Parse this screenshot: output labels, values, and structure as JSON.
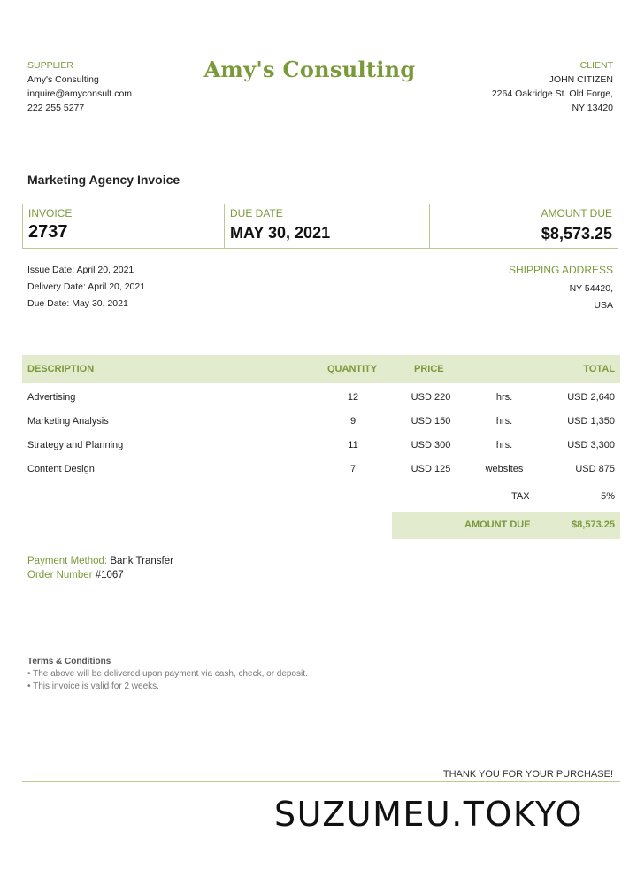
{
  "supplier": {
    "label": "SUPPLIER",
    "name": "Amy's Consulting",
    "email": "inquire@amyconsult.com",
    "phone": "222 255 5277"
  },
  "brand": "Amy's Consulting",
  "client": {
    "label": "CLIENT",
    "name": "JOHN CITIZEN",
    "address_line1": "2264 Oakridge St. Old Forge,",
    "address_line2": "NY 13420"
  },
  "invoice_title": "Marketing Agency Invoice",
  "summary": {
    "invoice_label": "INVOICE",
    "invoice_number": "2737",
    "due_label": "DUE DATE",
    "due_date": "MAY 30, 2021",
    "amount_label": "AMOUNT DUE",
    "amount": "$8,573.25"
  },
  "dates": {
    "issue": "Issue Date:  April 20, 2021",
    "delivery": "Delivery Date:  April 20, 2021",
    "due": "Due Date:  May 30, 2021"
  },
  "shipping": {
    "label": "SHIPPING ADDRESS",
    "line1": "NY 54420,",
    "line2": "USA"
  },
  "table": {
    "headers": {
      "description": "DESCRIPTION",
      "quantity": "QUANTITY",
      "price": "PRICE",
      "total": "TOTAL"
    },
    "rows": [
      {
        "description": "Advertising",
        "quantity": "12",
        "price": "USD 220",
        "unit": "hrs.",
        "total": "USD 2,640"
      },
      {
        "description": "Marketing Analysis",
        "quantity": "9",
        "price": "USD 150",
        "unit": "hrs.",
        "total": "USD 1,350"
      },
      {
        "description": "Strategy and Planning",
        "quantity": "11",
        "price": "USD 300",
        "unit": "hrs.",
        "total": "USD 3,300"
      },
      {
        "description": "Content Design",
        "quantity": "7",
        "price": "USD 125",
        "unit": "websites",
        "total": "USD 875"
      }
    ],
    "tax_label": "TAX",
    "tax_value": "5%",
    "amount_due_label": "AMOUNT DUE",
    "amount_due_value": "$8,573.25"
  },
  "payment": {
    "method_label": "Payment  Method:",
    "method_value": "Bank Transfer",
    "order_label": "Order Number",
    "order_value": "#1067"
  },
  "terms": {
    "title": "Terms & Conditions",
    "line1": "• The above will be delivered upon payment via cash, check, or deposit.",
    "line2": "• This invoice is valid for 2 weeks."
  },
  "thanks": "THANK  YOU FOR YOUR PURCHASE!",
  "watermark": "SUZUMEU.TOKYO"
}
